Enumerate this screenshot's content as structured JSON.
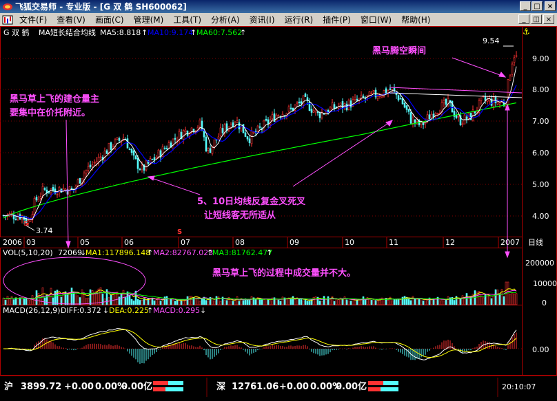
{
  "window": {
    "app_name": "飞狐交易师",
    "edition": "专业版",
    "stock_label": "[G 双 鹤 SH600062]"
  },
  "menu": [
    "文件(F)",
    "查看(V)",
    "画面(C)",
    "管理(M)",
    "工具(T)",
    "分析(A)",
    "资讯(I)",
    "运行(R)",
    "插件(P)",
    "窗口(W)",
    "帮助(H)"
  ],
  "main_panel": {
    "stock": "G 双  鹤",
    "indicator": "MA短长结合均线",
    "ma5": "MA5:8.818",
    "ma10": "MA10:9.174",
    "ma60": "MA60:7.562",
    "price_high": "9.54",
    "price_low": "3.74",
    "y_ticks": [
      "9.00",
      "8.00",
      "7.00",
      "6.00",
      "5.00",
      "4.00"
    ],
    "x_ticks": [
      "2006",
      "03",
      "05",
      "06",
      "07",
      "08",
      "09",
      "10",
      "11",
      "12",
      "2007"
    ],
    "period": "日线",
    "signal_mark": "S"
  },
  "annotations": [
    "黑马腾空瞬间",
    "黑马草上飞的建仓量主",
    "要集中在价托附近。",
    "5、10日均线反复金叉死叉",
    "让短线客无所适从",
    "黑马草上飞的过程中成交量并不大。"
  ],
  "volume_panel": {
    "label": "VOL(5,10,20)",
    "vol": "72069",
    "ma1": "MA1:117896.148",
    "ma2": "MA2:82767.023",
    "ma3": "MA3:81762.477",
    "y_ticks": [
      "200000",
      "100000",
      "0"
    ]
  },
  "macd_panel": {
    "label": "MACD(26,12,9)",
    "diff": "DIFF:0.372",
    "dea": "DEA:0.225",
    "macd": "MACD:0.295",
    "y_ticks": [
      "0.00"
    ]
  },
  "status": {
    "sh_label": "沪",
    "sh_index": "3899.72",
    "sh_change": "+0.00",
    "sh_pct": "0.00%",
    "sh_amount": "0.00亿",
    "sz_label": "深",
    "sz_index": "12761.06",
    "sz_change": "+0.00",
    "sz_pct": "0.00%",
    "sz_amount": "0.00亿",
    "time": "20:10:07"
  },
  "colors": {
    "up": "#ff3232",
    "down": "#54fcfc",
    "ma5": "#ffffff",
    "ma10": "#0000ff",
    "ma60": "#00ff00",
    "annotation": "#ff50ff",
    "axis": "#b00000"
  }
}
